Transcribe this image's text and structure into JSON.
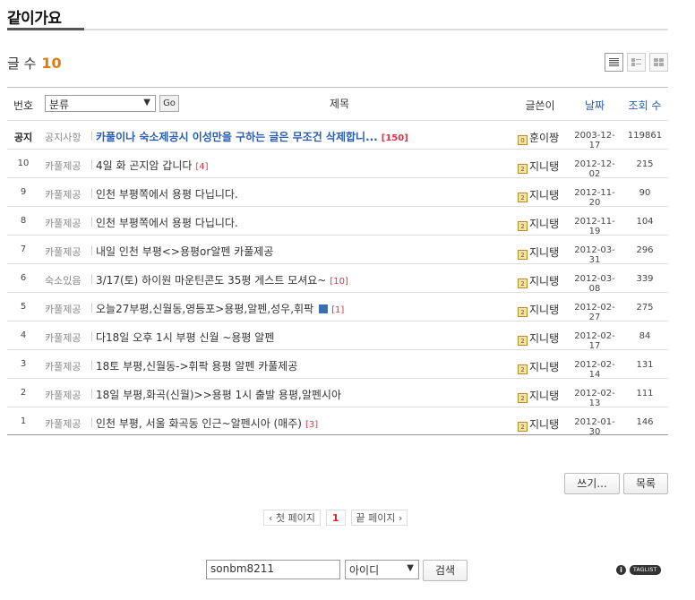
{
  "board": {
    "title": "같이가요"
  },
  "post_count": {
    "label": "글 수",
    "value": "10"
  },
  "table_header": {
    "no": "번호",
    "category_select": "분류",
    "go": "Go",
    "title": "제목",
    "author": "글쓴이",
    "date": "날짜",
    "views": "조회 수"
  },
  "rows": [
    {
      "no": "공지",
      "category": "공지사항",
      "title": "카풀이나 숙소제공시 이성만을 구하는 글은 무조건 삭제합니...",
      "comments": "[150]",
      "author": "훈이짱",
      "date": "2003-12-17",
      "views": "119861"
    },
    {
      "no": "10",
      "category": "카풀제공",
      "title": "4일 화 곤지암 갑니다",
      "comments": "[4]",
      "author": "지니탱",
      "date": "2012-12-02",
      "views": "215"
    },
    {
      "no": "9",
      "category": "카풀제공",
      "title": "인천 부평쪽에서 용평 다닙니다.",
      "comments": "",
      "author": "지니탱",
      "date": "2012-11-20",
      "views": "90"
    },
    {
      "no": "8",
      "category": "카풀제공",
      "title": "인천 부평쪽에서 용평 다닙니다.",
      "comments": "",
      "author": "지니탱",
      "date": "2012-11-19",
      "views": "104"
    },
    {
      "no": "7",
      "category": "카풀제공",
      "title": "내일 인천 부평<>용평or알펜 카풀제공",
      "comments": "",
      "author": "지니탱",
      "date": "2012-03-31",
      "views": "296"
    },
    {
      "no": "6",
      "category": "숙소있음",
      "title": "3/17(토) 하이원 마운틴콘도 35평 게스트 모셔요~",
      "comments": "[10]",
      "author": "지니탱",
      "date": "2012-03-08",
      "views": "339"
    },
    {
      "no": "5",
      "category": "카풀제공",
      "title": "오늘27부평,신월동,영등포>용평,알펜,성우,휘팍",
      "comments": "[1]",
      "author": "지니탱",
      "date": "2012-02-27",
      "views": "275",
      "has_file": true
    },
    {
      "no": "4",
      "category": "카풀제공",
      "title": "다18일 오후 1시 부평 신월 ~용평 알펜",
      "comments": "",
      "author": "지니탱",
      "date": "2012-02-17",
      "views": "84"
    },
    {
      "no": "3",
      "category": "카풀제공",
      "title": "18토 부평,신월동->휘팍 용평 알펜 카풀제공",
      "comments": "",
      "author": "지니탱",
      "date": "2012-02-14",
      "views": "131"
    },
    {
      "no": "2",
      "category": "카풀제공",
      "title": "18일 부평,화곡(신월)>>용평 1시 출발 용평,알펜시아",
      "comments": "",
      "author": "지니탱",
      "date": "2012-02-13",
      "views": "111"
    },
    {
      "no": "1",
      "category": "카풀제공",
      "title": "인천 부평, 서울 화곡동 인근~알펜시아 (매주)",
      "comments": "[3]",
      "author": "지니탱",
      "date": "2012-01-30",
      "views": "146"
    }
  ],
  "buttons": {
    "write": "쓰기...",
    "list": "목록"
  },
  "pagination": {
    "first": "‹ 첫 페이지",
    "current": "1",
    "last": "끝 페이지 ›"
  },
  "search": {
    "value": "sonbm8211",
    "field": "아이디",
    "button": "검색"
  },
  "footer": {
    "taglist": "TAGLIST",
    "info": "i"
  },
  "colors": {
    "accent": "#e07a12",
    "link": "#2a5db0",
    "comment": "#d34444"
  }
}
